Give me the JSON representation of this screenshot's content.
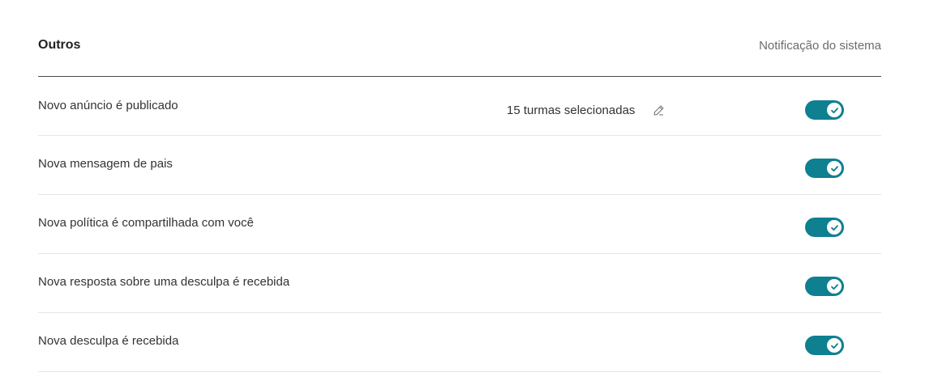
{
  "section": {
    "title": "Outros",
    "column_header": "Notificação do sistema"
  },
  "rows": [
    {
      "label": "Novo anúncio é publicado",
      "selection": "15 turmas selecionadas",
      "enabled": true
    },
    {
      "label": "Nova mensagem de pais",
      "enabled": true
    },
    {
      "label": "Nova política é compartilhada com você",
      "enabled": true
    },
    {
      "label": "Nova resposta sobre uma desculpa é recebida",
      "enabled": true
    },
    {
      "label": "Nova desculpa é recebida",
      "enabled": true
    }
  ],
  "colors": {
    "toggle_on": "#0e8090",
    "divider_strong": "#4a4a4a",
    "divider_light": "#e6e6e6"
  },
  "icons": {
    "edit": "pencil-icon",
    "toggle_check": "check-icon"
  }
}
